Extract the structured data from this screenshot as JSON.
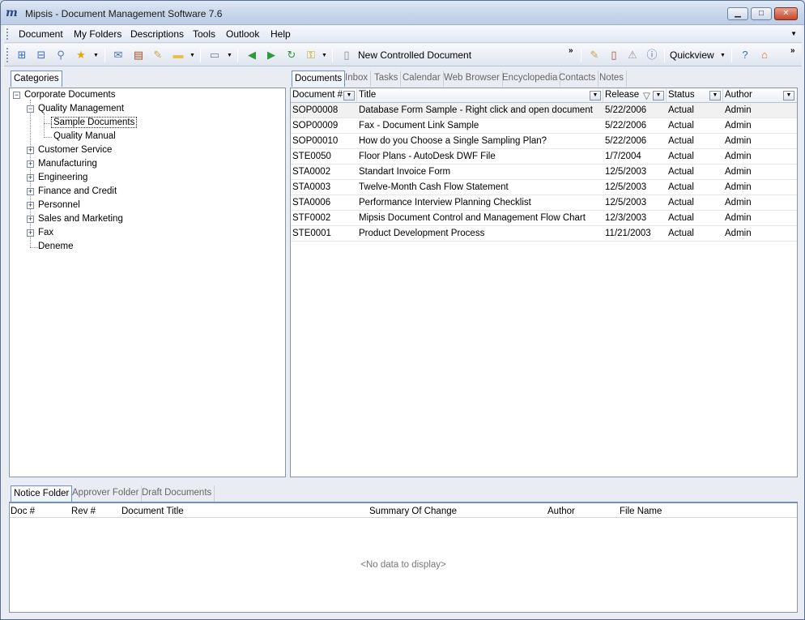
{
  "window": {
    "title": "Mipsis - Document Management Software 7.6",
    "logo": "m",
    "buttons": {
      "minimize": "▁",
      "maximize": "□",
      "close": "✕"
    }
  },
  "menu": [
    "Document",
    "My Folders",
    "Descriptions",
    "Tools",
    "Outlook",
    "Help"
  ],
  "toolbar": {
    "new_controlled_label": "New Controlled Document",
    "quickview_label": "Quickview",
    "icons": [
      "add-child-node-icon",
      "add-node-icon",
      "search-icon",
      "favorites-star-icon",
      "mail-icon",
      "calendar-icon",
      "notes-icon",
      "folder-icon",
      "keyboard-icon",
      "back-arrow-icon",
      "forward-arrow-icon",
      "refresh-icon",
      "lock-icon",
      "new-document-icon",
      "edit-document-icon",
      "document-icon",
      "warning-icon",
      "info-icon",
      "help-icon",
      "home-icon"
    ]
  },
  "left_panel": {
    "tab": "Categories",
    "tree": [
      {
        "label": "Corporate Documents",
        "level": 0,
        "expander": "−"
      },
      {
        "label": "Quality Management",
        "level": 1,
        "expander": "−"
      },
      {
        "label": "Sample Documents",
        "level": 2,
        "expander": "",
        "selected": true
      },
      {
        "label": "Quality Manual",
        "level": 2,
        "expander": ""
      },
      {
        "label": "Customer Service",
        "level": 1,
        "expander": "+"
      },
      {
        "label": "Manufacturing",
        "level": 1,
        "expander": "+"
      },
      {
        "label": "Engineering",
        "level": 1,
        "expander": "+"
      },
      {
        "label": "Finance and Credit",
        "level": 1,
        "expander": "+"
      },
      {
        "label": "Personnel",
        "level": 1,
        "expander": "+"
      },
      {
        "label": "Sales and Marketing",
        "level": 1,
        "expander": "+"
      },
      {
        "label": "Fax",
        "level": 1,
        "expander": "+"
      },
      {
        "label": "Deneme",
        "level": 1,
        "expander": ""
      }
    ]
  },
  "right_panel": {
    "tabs": [
      "Documents",
      "Inbox",
      "Tasks",
      "Calendar",
      "Web Browser",
      "Encyclopedia",
      "Contacts",
      "Notes"
    ],
    "active_tab": "Documents",
    "columns": [
      "Document #",
      "Title",
      "Release",
      "Status",
      "Author"
    ],
    "sort_glyph": "▽",
    "filter_glyph": "▼",
    "rows": [
      [
        "SOP00008",
        "Database Form Sample - Right click and open document",
        "5/22/2006",
        "Actual",
        "Admin"
      ],
      [
        "SOP00009",
        "Fax - Document Link Sample",
        "5/22/2006",
        "Actual",
        "Admin"
      ],
      [
        "SOP00010",
        "How do you Choose a Single Sampling Plan?",
        "5/22/2006",
        "Actual",
        "Admin"
      ],
      [
        "STE0050",
        "Floor Plans - AutoDesk DWF File",
        "1/7/2004",
        "Actual",
        "Admin"
      ],
      [
        "STA0002",
        "Standart Invoice Form",
        "12/5/2003",
        "Actual",
        "Admin"
      ],
      [
        "STA0003",
        "Twelve-Month Cash Flow Statement",
        "12/5/2003",
        "Actual",
        "Admin"
      ],
      [
        "STA0006",
        "Performance Interview Planning Checklist",
        "12/5/2003",
        "Actual",
        "Admin"
      ],
      [
        "STF0002",
        "Mipsis Document Control and Management Flow Chart",
        "12/3/2003",
        "Actual",
        "Admin"
      ],
      [
        "STE0001",
        "Product Development Process",
        "11/21/2003",
        "Actual",
        "Admin"
      ]
    ]
  },
  "bottom_panel": {
    "tabs": [
      "Notice Folder",
      "Approver Folder",
      "Draft Documents"
    ],
    "active_tab": "Notice Folder",
    "columns": [
      "Doc #",
      "Rev #",
      "Document Title",
      "Summary Of Change",
      "Author",
      "File Name"
    ],
    "empty_text": "<No data to display>"
  }
}
